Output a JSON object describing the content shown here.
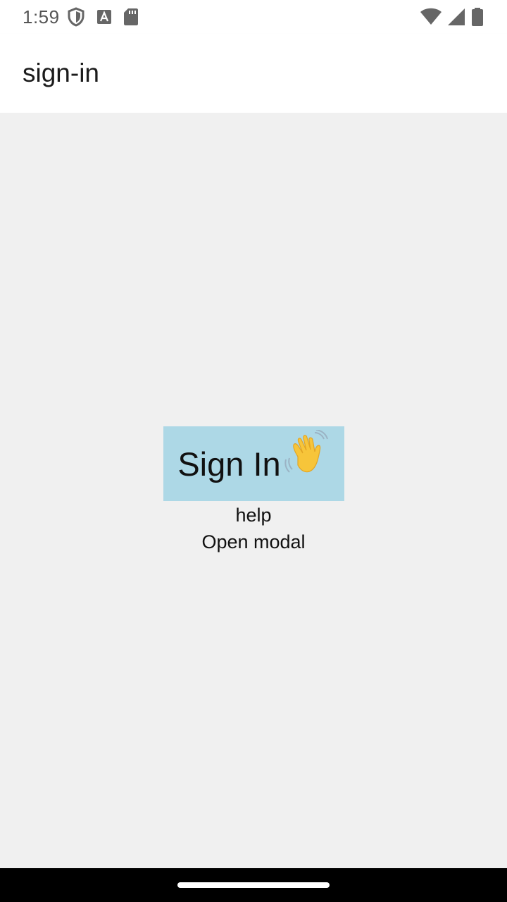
{
  "status_bar": {
    "time": "1:59",
    "left_icons": [
      "shield-icon",
      "font-a-icon",
      "sd-card-icon"
    ],
    "right_icons": [
      "wifi-icon",
      "cellular-signal-icon",
      "battery-icon"
    ]
  },
  "app_bar": {
    "title": "sign-in"
  },
  "main": {
    "signin_label": "Sign In",
    "signin_emoji": "waving-hand-icon",
    "help_label": "help",
    "modal_label": "Open modal"
  },
  "colors": {
    "button_bg": "#add8e6",
    "background": "#f0f0f0",
    "app_bar": "#ffffff",
    "nav_bar": "#000000"
  }
}
